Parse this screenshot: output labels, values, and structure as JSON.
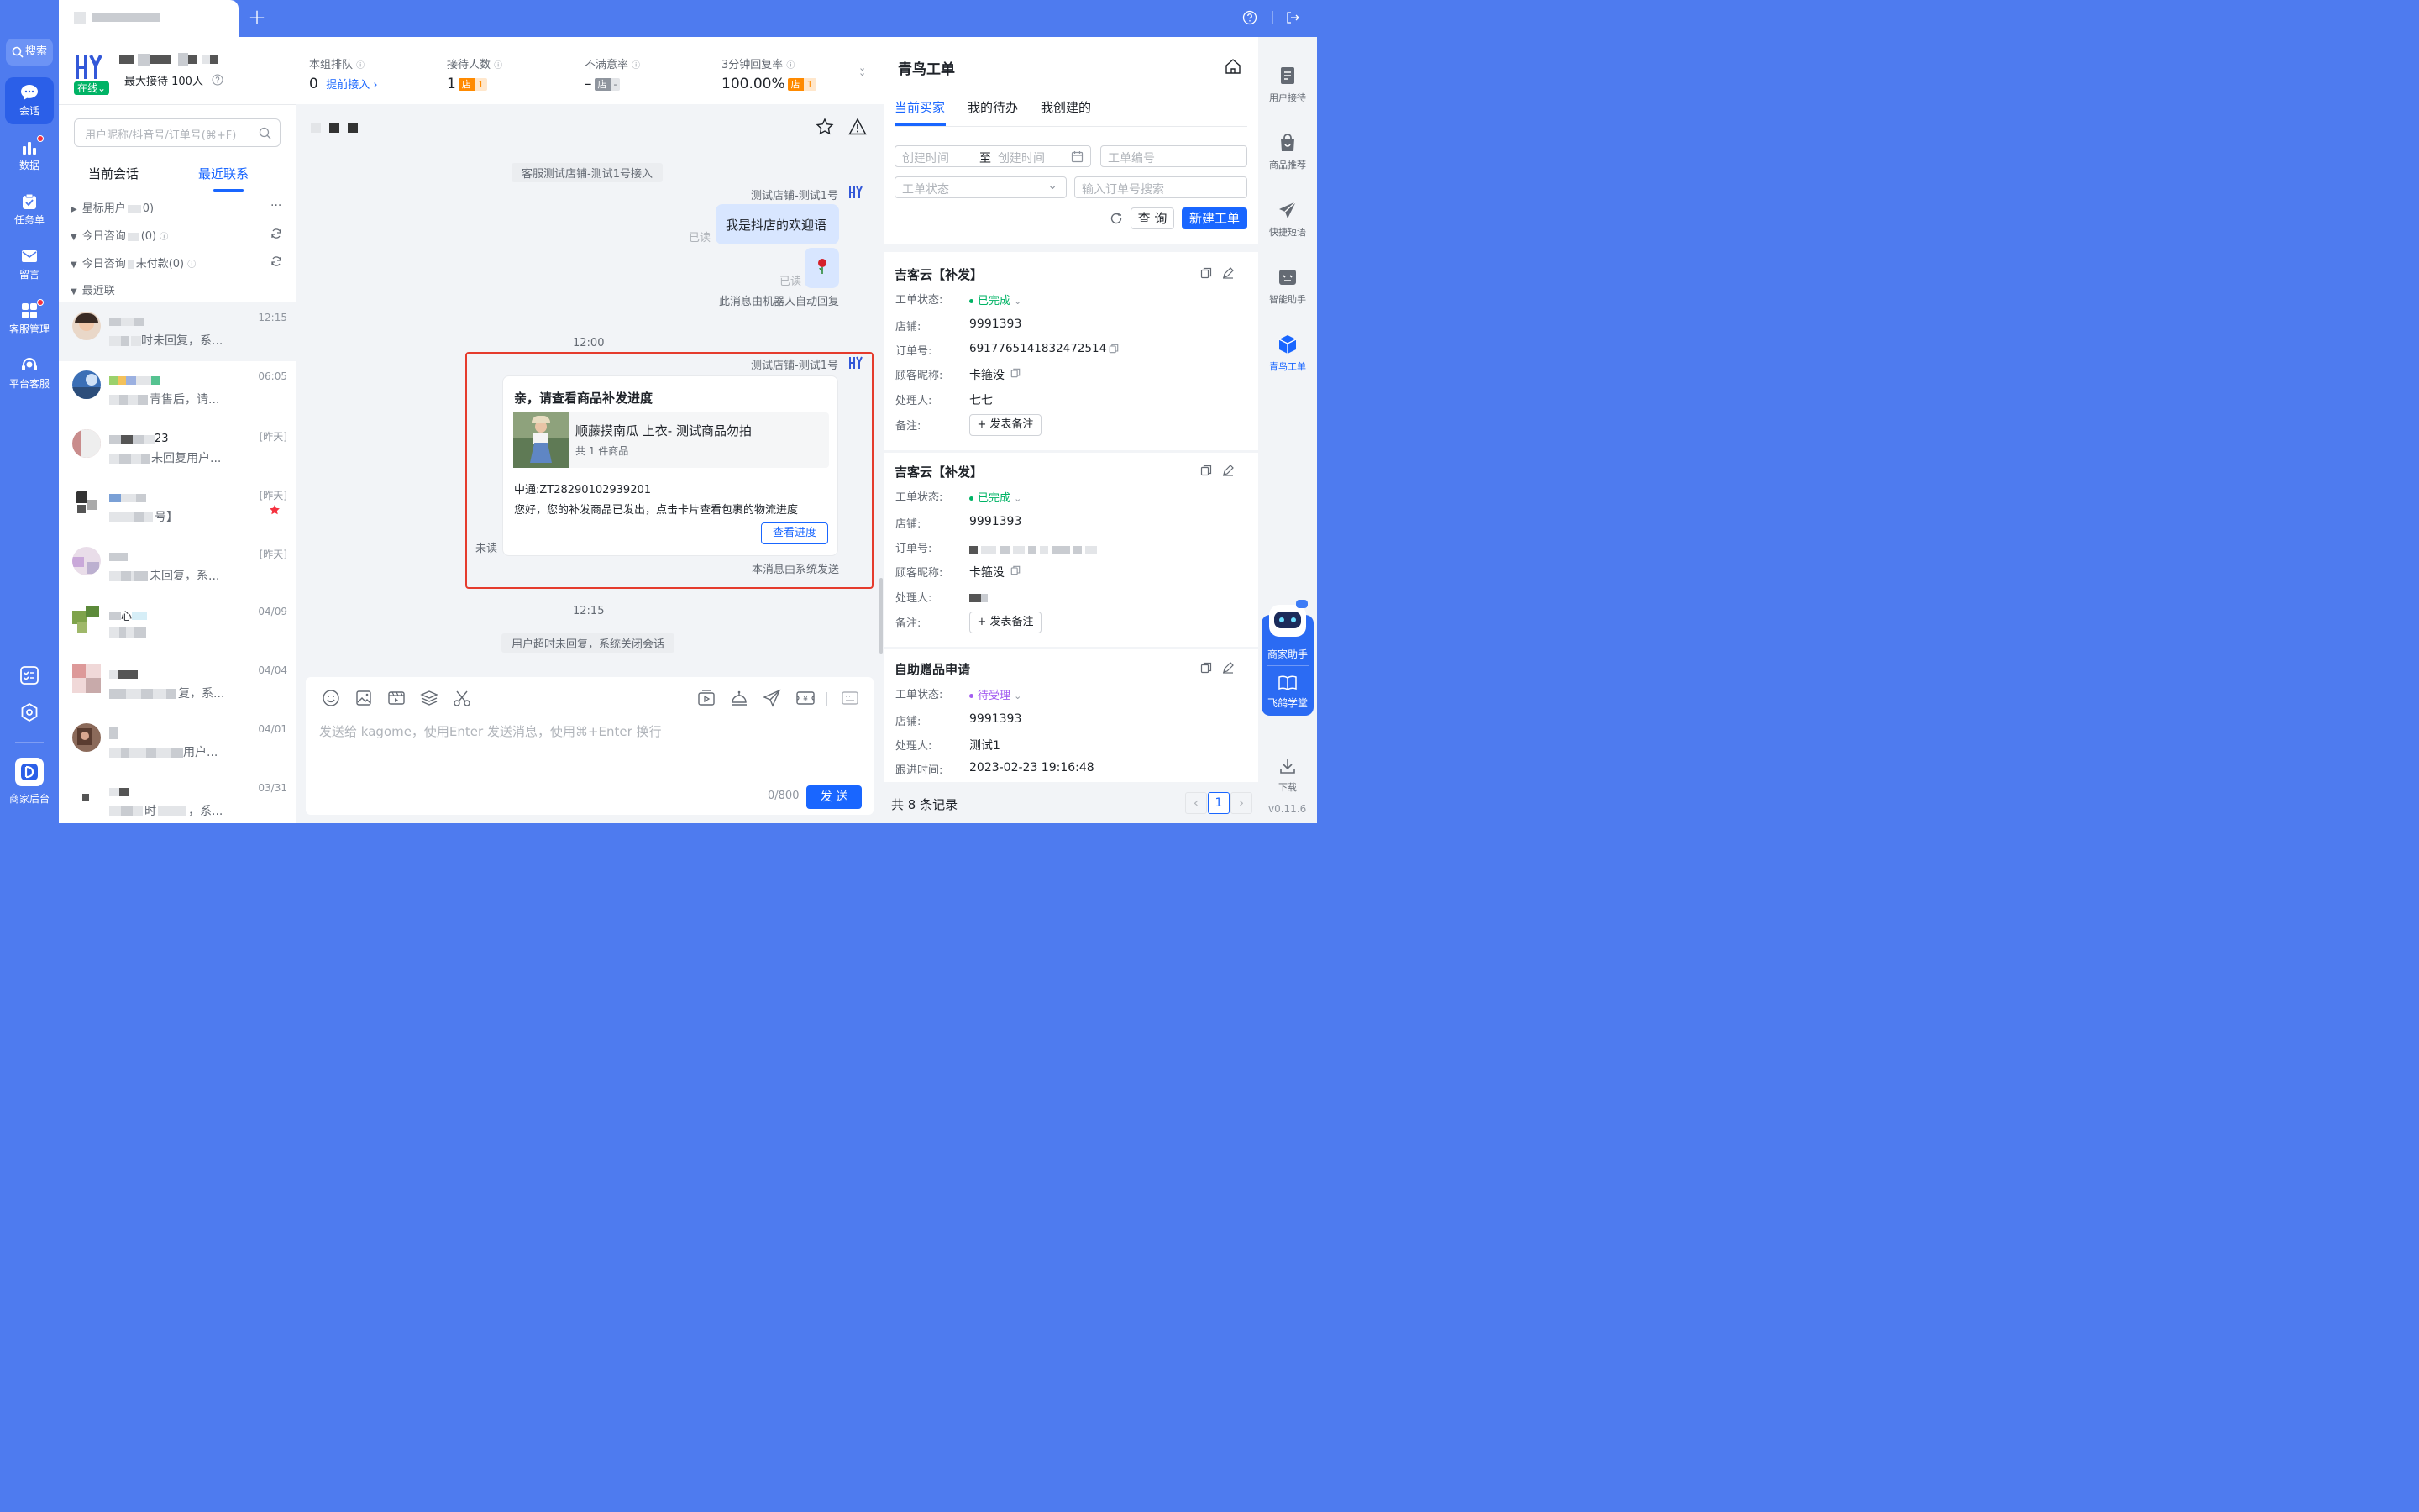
{
  "sidebar": {
    "search": "搜索",
    "items": [
      "会话",
      "数据",
      "任务单",
      "留言",
      "客服管理",
      "平台客服"
    ],
    "bottom": "商家后台"
  },
  "topbar": {
    "add": "+"
  },
  "agent": {
    "status": "在线",
    "max_reception": "最大接待 100人"
  },
  "session_search": {
    "placeholder": "用户昵称/抖音号/订单号(⌘+F)"
  },
  "session_tabs": [
    "当前会话",
    "最近联系"
  ],
  "groups": {
    "starred": "星标用户",
    "starred_count": "0)",
    "today1": "今日咨询",
    "today1_tail": "(0)",
    "today2": "今日咨询",
    "today2_tail": "未付款(0)",
    "recent": "最近联"
  },
  "sessions": [
    {
      "time": "12:15",
      "preview": "时未回复，系..."
    },
    {
      "time": "06:05",
      "preview": "青售后，请..."
    },
    {
      "time": "[昨天]",
      "name_tail": "23",
      "preview": "未回复用户..."
    },
    {
      "time": "[昨天]",
      "preview": "号】"
    },
    {
      "time": "[昨天]",
      "preview": "未回复，系..."
    },
    {
      "time": "04/09",
      "name_tail": "心",
      "preview": ""
    },
    {
      "time": "04/04",
      "preview": "复，系..."
    },
    {
      "time": "04/01",
      "preview": "用户..."
    },
    {
      "time": "03/31",
      "preview": "时",
      "preview2": "，系..."
    }
  ],
  "stats": [
    {
      "label": "本组排队",
      "value": "0",
      "link": "提前接入 ›"
    },
    {
      "label": "接待人数",
      "value": "1",
      "tag": "店",
      "tagval": "1"
    },
    {
      "label": "不满意率",
      "value": "–",
      "tag": "店",
      "tagval": "-"
    },
    {
      "label": "3分钟回复率",
      "value": "100.00%",
      "tag": "店",
      "tagval": "1"
    }
  ],
  "chat": {
    "sys_join": "客服测试店铺-测试1号接入",
    "sender": "测试店铺-测试1号",
    "welcome": "我是抖店的欢迎语",
    "read": "已读",
    "robot_note": "此消息由机器人自动回复",
    "time1": "12:00",
    "card_title": "亲，请查看商品补发进度",
    "product_name": "顺藤摸南瓜 上衣- 测试商品勿拍",
    "product_count": "共 1 件商品",
    "express": "中通:ZT28290102939201",
    "desc": "您好，您的补发商品已发出，点击卡片查看包裹的物流进度",
    "view_btn": "查看进度",
    "unread": "未读",
    "system_note": "本消息由系统发送",
    "time2": "12:15",
    "sys_close": "用户超时未回复，系统关闭会话",
    "input_placeholder": "发送给 kagome，使用Enter 发送消息，使用⌘+Enter 换行",
    "counter": "0/800",
    "send": "发 送"
  },
  "tickets": {
    "title": "青鸟工单",
    "tabs": [
      "当前买家",
      "我的待办",
      "我创建的"
    ],
    "create_time": "创建时间",
    "to": "至",
    "ticket_no": "工单编号",
    "status_ph": "工单状态",
    "order_ph": "输入订单号搜索",
    "query": "查 询",
    "new": "新建工单",
    "labels": {
      "status": "工单状态:",
      "shop": "店铺:",
      "order": "订单号:",
      "nick": "顾客昵称:",
      "handler": "处理人:",
      "remark": "备注:",
      "follow": "跟进时间:"
    },
    "add_remark": "+ 发表备注",
    "cards": [
      {
        "title": "吉客云【补发】",
        "status": "已完成",
        "shop": "9991393",
        "order": "6917765141832472514",
        "nick": "卡箍没",
        "handler": "七七"
      },
      {
        "title": "吉客云【补发】",
        "status": "已完成",
        "shop": "9991393",
        "nick": "卡箍没"
      },
      {
        "title": "自助赠品申请",
        "status": "待受理",
        "shop": "9991393",
        "handler": "测试1",
        "follow": "2023-02-23 19:16:48"
      }
    ],
    "total": "共 8 条记录",
    "page": "1"
  },
  "rightnav": {
    "items": [
      "用户接待",
      "商品推荐",
      "快捷短语",
      "智能助手",
      "青鸟工单"
    ],
    "assistant": "商家助手",
    "school": "飞鸽学堂",
    "download": "下载",
    "version": "v0.11.6"
  },
  "colors": {
    "brand": "#4E7BEF",
    "primary": "#1966FF",
    "success": "#00B365",
    "pending": "#A35CF0",
    "highlight": "#E53B2D",
    "shoptag": "#FF8A00"
  }
}
